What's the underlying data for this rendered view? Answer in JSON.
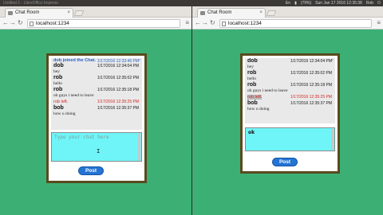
{
  "topbar": {
    "left_title": "Untitled 1 - LibreOffice Impress",
    "keyboard": "En",
    "battery": "(79%)",
    "clock": "Sun Jan 17 2016 12:35:38",
    "user": "Rob"
  },
  "windows": [
    {
      "tab_title": "Chat Room",
      "url": "localhost:1234",
      "messages": [
        {
          "kind": "system",
          "user": "dob joined the Chat.",
          "time": "1/17/2016 12:33:46 PM",
          "text": ""
        },
        {
          "kind": "normal",
          "user": "dob",
          "time": "1/17/2016 12:34:04 PM",
          "text": "hey"
        },
        {
          "kind": "normal",
          "user": "rob",
          "time": "1/17/2016 12:35:02 PM",
          "text": "hello"
        },
        {
          "kind": "normal",
          "user": "rob",
          "time": "1/17/2016 12:35:18 PM",
          "text": "oh guys i need to leave"
        },
        {
          "kind": "left",
          "user": "rob left.",
          "time": "1/17/2016 12:35:25 PM",
          "text": ""
        },
        {
          "kind": "normal",
          "user": "bob",
          "time": "1/17/2016 12:35:37 PM",
          "text": "how u doing"
        }
      ],
      "input_placeholder": "Type your chat here",
      "input_value": "",
      "post_label": "Post"
    },
    {
      "tab_title": "Chat Room",
      "url": "localhost:1234",
      "messages": [
        {
          "kind": "normal",
          "user": "dob",
          "time": "1/17/2016 12:34:04 PM",
          "text": "hey"
        },
        {
          "kind": "normal",
          "user": "rob",
          "time": "1/17/2016 12:35:02 PM",
          "text": "hello"
        },
        {
          "kind": "normal",
          "user": "rob",
          "time": "1/17/2016 12:35:18 PM",
          "text": "oh guys i need to leave"
        },
        {
          "kind": "left",
          "user": "rob left.",
          "time": "1/17/2016 12:35:25 PM",
          "text": ""
        },
        {
          "kind": "normal",
          "user": "bob",
          "time": "1/17/2016 12:35:37 PM",
          "text": "how u doing"
        }
      ],
      "input_placeholder": "",
      "input_value": "ok",
      "post_label": "Post"
    }
  ],
  "colors": {
    "page_bg": "#3cb074",
    "chat_border": "#5a4a1e",
    "compose_bg": "#6ff5f7",
    "post_button": "#2474d4",
    "system_text": "#2a62c8",
    "leave_text": "#d42424"
  }
}
